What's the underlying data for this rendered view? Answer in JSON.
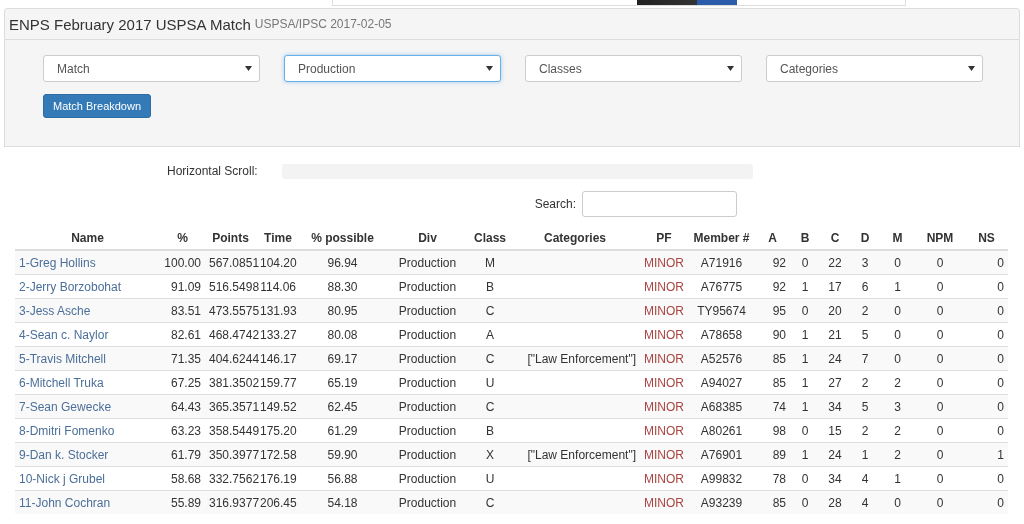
{
  "header": {
    "title": "ENPS February 2017 USPSA Match",
    "subtitle": "USPSA/IPSC 2017-02-05"
  },
  "filters": [
    {
      "value": "Match",
      "focused": false
    },
    {
      "value": "Production",
      "focused": true
    },
    {
      "value": "Classes",
      "focused": false
    },
    {
      "value": "Categories",
      "focused": false
    }
  ],
  "breakdown_button": "Match Breakdown",
  "horizontal_scroll": {
    "label": "Horizontal Scroll:"
  },
  "search": {
    "label": "Search:"
  },
  "table": {
    "columns": [
      "Name",
      "%",
      "Points",
      "Time",
      "% possible",
      "Div",
      "Class",
      "Categories",
      "PF",
      "Member #",
      "A",
      "B",
      "C",
      "D",
      "M",
      "NPM",
      "NS"
    ],
    "rows": [
      {
        "name": "1-Greg Hollins",
        "pct": "100.00",
        "points": "567.0851",
        "time": "104.20",
        "possible": "96.94",
        "div": "Production",
        "class": "M",
        "pf": "MINOR",
        "member": "A71916",
        "a": "92",
        "b": "0",
        "c": "22",
        "d": "3",
        "m": "0",
        "npm": "0",
        "ns": "0"
      },
      {
        "name": "2-Jerry Borzobohat",
        "pct": "91.09",
        "points": "516.5498",
        "time": "114.06",
        "possible": "88.30",
        "div": "Production",
        "class": "B",
        "pf": "MINOR",
        "member": "A76775",
        "a": "92",
        "b": "1",
        "c": "17",
        "d": "6",
        "m": "1",
        "npm": "0",
        "ns": "0"
      },
      {
        "name": "3-Jess Asche",
        "pct": "83.51",
        "points": "473.5575",
        "time": "131.93",
        "possible": "80.95",
        "div": "Production",
        "class": "C",
        "pf": "MINOR",
        "member": "TY95674",
        "a": "95",
        "b": "0",
        "c": "20",
        "d": "2",
        "m": "0",
        "npm": "0",
        "ns": "0"
      },
      {
        "name": "4-Sean c. Naylor",
        "pct": "82.61",
        "points": "468.4742",
        "time": "133.27",
        "possible": "80.08",
        "div": "Production",
        "class": "A",
        "pf": "MINOR",
        "member": "A78658",
        "a": "90",
        "b": "1",
        "c": "21",
        "d": "5",
        "m": "0",
        "npm": "0",
        "ns": "0"
      },
      {
        "name": "5-Travis Mitchell",
        "pct": "71.35",
        "points": "404.6244",
        "time": "146.17",
        "possible": "69.17",
        "div": "Production",
        "class": "C",
        "categories": "[\"Law Enforcement\"]",
        "pf": "MINOR",
        "member": "A52576",
        "a": "85",
        "b": "1",
        "c": "24",
        "d": "7",
        "m": "0",
        "npm": "0",
        "ns": "0"
      },
      {
        "name": "6-Mitchell Truka",
        "pct": "67.25",
        "points": "381.3502",
        "time": "159.77",
        "possible": "65.19",
        "div": "Production",
        "class": "U",
        "pf": "MINOR",
        "member": "A94027",
        "a": "85",
        "b": "1",
        "c": "27",
        "d": "2",
        "m": "2",
        "npm": "0",
        "ns": "0"
      },
      {
        "name": "7-Sean Gewecke",
        "pct": "64.43",
        "points": "365.3571",
        "time": "149.52",
        "possible": "62.45",
        "div": "Production",
        "class": "C",
        "pf": "MINOR",
        "member": "A68385",
        "a": "74",
        "b": "1",
        "c": "34",
        "d": "5",
        "m": "3",
        "npm": "0",
        "ns": "0"
      },
      {
        "name": "8-Dmitri Fomenko",
        "pct": "63.23",
        "points": "358.5449",
        "time": "175.20",
        "possible": "61.29",
        "div": "Production",
        "class": "B",
        "pf": "MINOR",
        "member": "A80261",
        "a": "98",
        "b": "0",
        "c": "15",
        "d": "2",
        "m": "2",
        "npm": "0",
        "ns": "0"
      },
      {
        "name": "9-Dan k. Stocker",
        "pct": "61.79",
        "points": "350.3977",
        "time": "172.58",
        "possible": "59.90",
        "div": "Production",
        "class": "X",
        "categories": "[\"Law Enforcement\"]",
        "pf": "MINOR",
        "member": "A76901",
        "a": "89",
        "b": "1",
        "c": "24",
        "d": "1",
        "m": "2",
        "npm": "0",
        "ns": "1"
      },
      {
        "name": "10-Nick j Grubel",
        "pct": "58.68",
        "points": "332.7562",
        "time": "176.19",
        "possible": "56.88",
        "div": "Production",
        "class": "U",
        "pf": "MINOR",
        "member": "A99832",
        "a": "78",
        "b": "0",
        "c": "34",
        "d": "4",
        "m": "1",
        "npm": "0",
        "ns": "0"
      },
      {
        "name": "11-John Cochran",
        "pct": "55.89",
        "points": "316.9377",
        "time": "206.45",
        "possible": "54.18",
        "div": "Production",
        "class": "C",
        "pf": "MINOR",
        "member": "A93239",
        "a": "85",
        "b": "0",
        "c": "28",
        "d": "4",
        "m": "0",
        "npm": "0",
        "ns": "0"
      }
    ]
  }
}
